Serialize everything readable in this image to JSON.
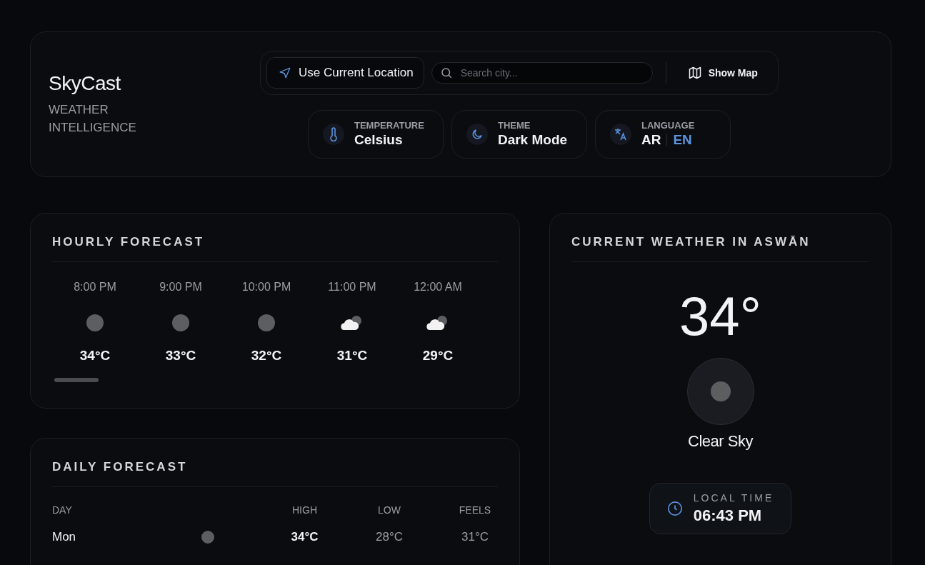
{
  "brand": {
    "name": "SkyCast",
    "tagline": "WEATHER INTELLIGENCE"
  },
  "toolbar": {
    "location_button": "Use Current Location",
    "search": {
      "placeholder": "Search city..."
    },
    "map_button": "Show Map"
  },
  "settings": [
    {
      "kind": "temperature",
      "label": "TEMPERATURE",
      "value": "Celsius"
    },
    {
      "kind": "theme",
      "label": "THEME",
      "value": "Dark Mode"
    },
    {
      "kind": "language",
      "label": "LANGUAGE",
      "options": [
        {
          "label": "AR",
          "selected": false
        },
        {
          "label": "EN",
          "selected": true
        }
      ]
    }
  ],
  "hourly": {
    "title": "HOURLY FORECAST",
    "items": [
      {
        "time": "8:00 PM",
        "kind": "clear",
        "temp": "34°C"
      },
      {
        "time": "9:00 PM",
        "kind": "clear",
        "temp": "33°C"
      },
      {
        "time": "10:00 PM",
        "kind": "clear",
        "temp": "32°C"
      },
      {
        "time": "11:00 PM",
        "kind": "partly-cloudy",
        "temp": "31°C"
      },
      {
        "time": "12:00 AM",
        "kind": "partly-cloudy",
        "temp": "29°C"
      }
    ]
  },
  "daily": {
    "title": "DAILY FORECAST",
    "columns": [
      "DAY",
      "HIGH",
      "LOW",
      "FEELS"
    ],
    "rows": [
      {
        "day": "Mon",
        "kind": "clear",
        "high": "34°C",
        "low": "28°C",
        "feels": "31°C"
      }
    ]
  },
  "current": {
    "title": "CURRENT WEATHER IN ASWĀN",
    "temperature": "34°",
    "kind": "clear",
    "condition": "Clear Sky",
    "local_time": {
      "label": "LOCAL TIME",
      "value": "06:43 PM"
    }
  }
}
